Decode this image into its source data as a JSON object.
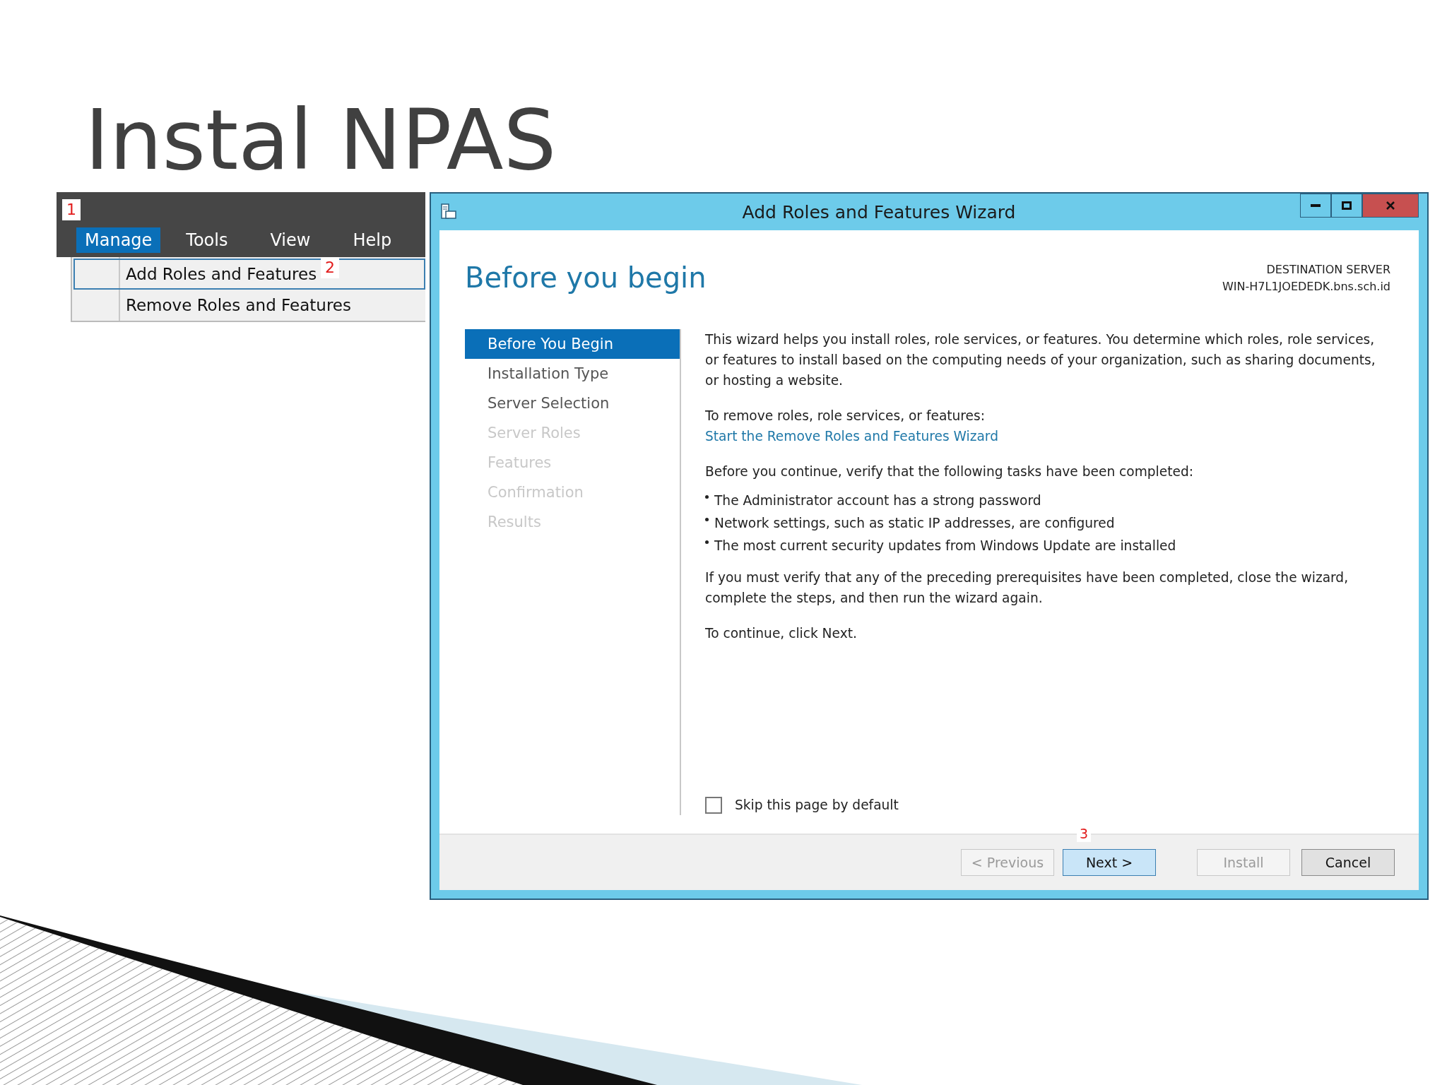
{
  "slide_title": "Instal NPAS",
  "menu_bar": {
    "marker": "1",
    "items": [
      {
        "label": "Manage",
        "selected": true
      },
      {
        "label": "Tools",
        "selected": false
      },
      {
        "label": "View",
        "selected": false
      },
      {
        "label": "Help",
        "selected": false
      }
    ]
  },
  "dropdown": {
    "marker": "2",
    "items": [
      {
        "label": "Add Roles and Features",
        "selected": true
      },
      {
        "label": "Remove Roles and Features",
        "selected": false
      }
    ]
  },
  "wizard": {
    "title": "Add Roles and Features Wizard",
    "page_title": "Before you begin",
    "destination_label": "DESTINATION SERVER",
    "destination_server": "WIN-H7L1JOEDEDK.bns.sch.id",
    "steps": [
      {
        "label": "Before You Begin",
        "selected": true,
        "disabled": false
      },
      {
        "label": "Installation Type",
        "selected": false,
        "disabled": false
      },
      {
        "label": "Server Selection",
        "selected": false,
        "disabled": false
      },
      {
        "label": "Server Roles",
        "selected": false,
        "disabled": true
      },
      {
        "label": "Features",
        "selected": false,
        "disabled": true
      },
      {
        "label": "Confirmation",
        "selected": false,
        "disabled": true
      },
      {
        "label": "Results",
        "selected": false,
        "disabled": true
      }
    ],
    "intro": "This wizard helps you install roles, role services, or features. You determine which roles, role services, or features to install based on the computing needs of your organization, such as sharing documents, or hosting a website.",
    "remove_label": "To remove roles, role services, or features:",
    "remove_link": "Start the Remove Roles and Features Wizard",
    "verify_intro": "Before you continue, verify that the following tasks have been completed:",
    "tasks": [
      "The Administrator account has a strong password",
      "Network settings, such as static IP addresses, are configured",
      "The most current security updates from Windows Update are installed"
    ],
    "verify_note": "If you must verify that any of the preceding prerequisites have been completed, close the wizard, complete the steps, and then run the wizard again.",
    "continue_note": "To continue, click Next.",
    "skip_checkbox": {
      "label": "Skip this page by default",
      "checked": false
    },
    "marker": "3",
    "buttons": [
      {
        "label": "< Previous",
        "disabled": true,
        "default": false
      },
      {
        "label": "Next >",
        "disabled": false,
        "default": true
      },
      {
        "label": "Install",
        "disabled": true,
        "default": false
      },
      {
        "label": "Cancel",
        "disabled": false,
        "default": false
      }
    ]
  }
}
